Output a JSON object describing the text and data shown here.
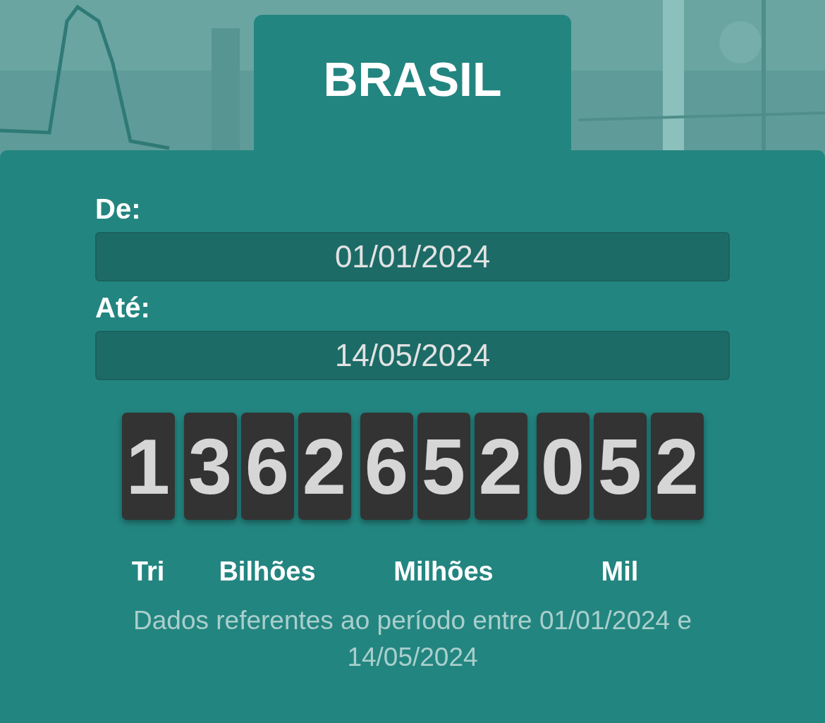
{
  "tab": {
    "title": "BRASIL"
  },
  "fields": [
    {
      "label": "De:",
      "value": "01/01/2024"
    },
    {
      "label": "Até:",
      "value": "14/05/2024"
    }
  ],
  "counter": [
    {
      "digits": "1",
      "label": "Tri"
    },
    {
      "digits": "362",
      "label": "Bilhões"
    },
    {
      "digits": "652",
      "label": "Milhões"
    },
    {
      "digits": "052",
      "label": "Mil"
    }
  ],
  "note": "Dados referentes ao período entre 01/01/2024 e 14/05/2024"
}
